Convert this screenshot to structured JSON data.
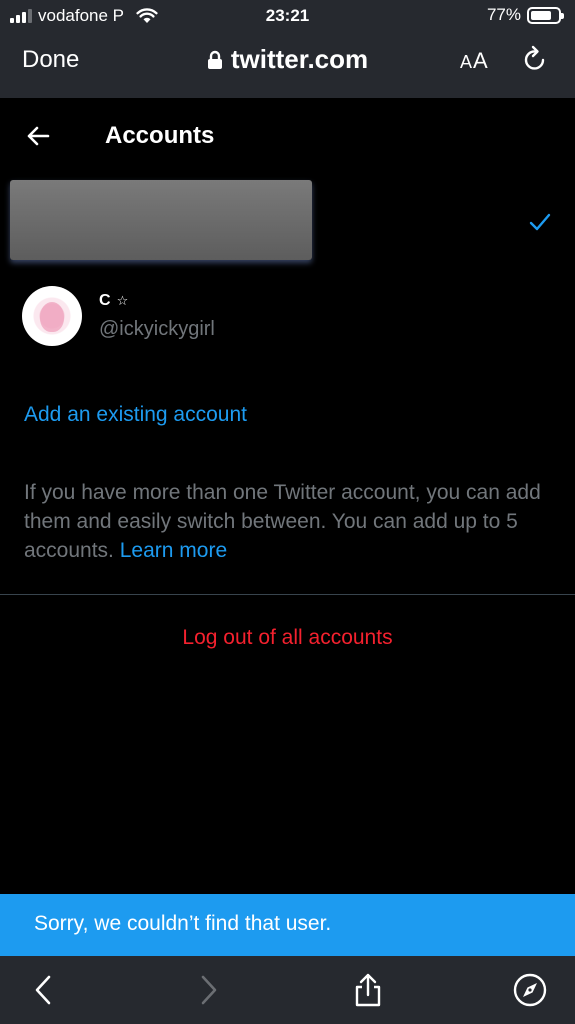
{
  "status_bar": {
    "carrier": "vodafone P",
    "time": "23:21",
    "battery": "77%",
    "battery_level": 0.77
  },
  "safari": {
    "done_label": "Done",
    "url": "twitter.com",
    "text_size_label_small": "A",
    "text_size_label_large": "A"
  },
  "header": {
    "title": "Accounts"
  },
  "accounts": [
    {
      "display_name": "C",
      "handle": "@ickyickygirl"
    }
  ],
  "add_account_label": "Add an existing account",
  "info": {
    "text": "If you have more than one Twitter account, you can add them and easily switch between. You can add up to 5 accounts. ",
    "link": "Learn more"
  },
  "logout_label": "Log out of all accounts",
  "toast": "Sorry, we couldn’t find that user.",
  "colors": {
    "accent": "#1d9bf0",
    "danger": "#f4212e",
    "secondary_text": "#71767b",
    "chrome": "#26292f"
  },
  "icons": [
    "wifi-icon",
    "lock-icon",
    "reload-icon",
    "back-arrow-icon",
    "check-icon",
    "star-icon",
    "back-chevron-icon",
    "forward-chevron-icon",
    "share-icon",
    "compass-icon"
  ]
}
